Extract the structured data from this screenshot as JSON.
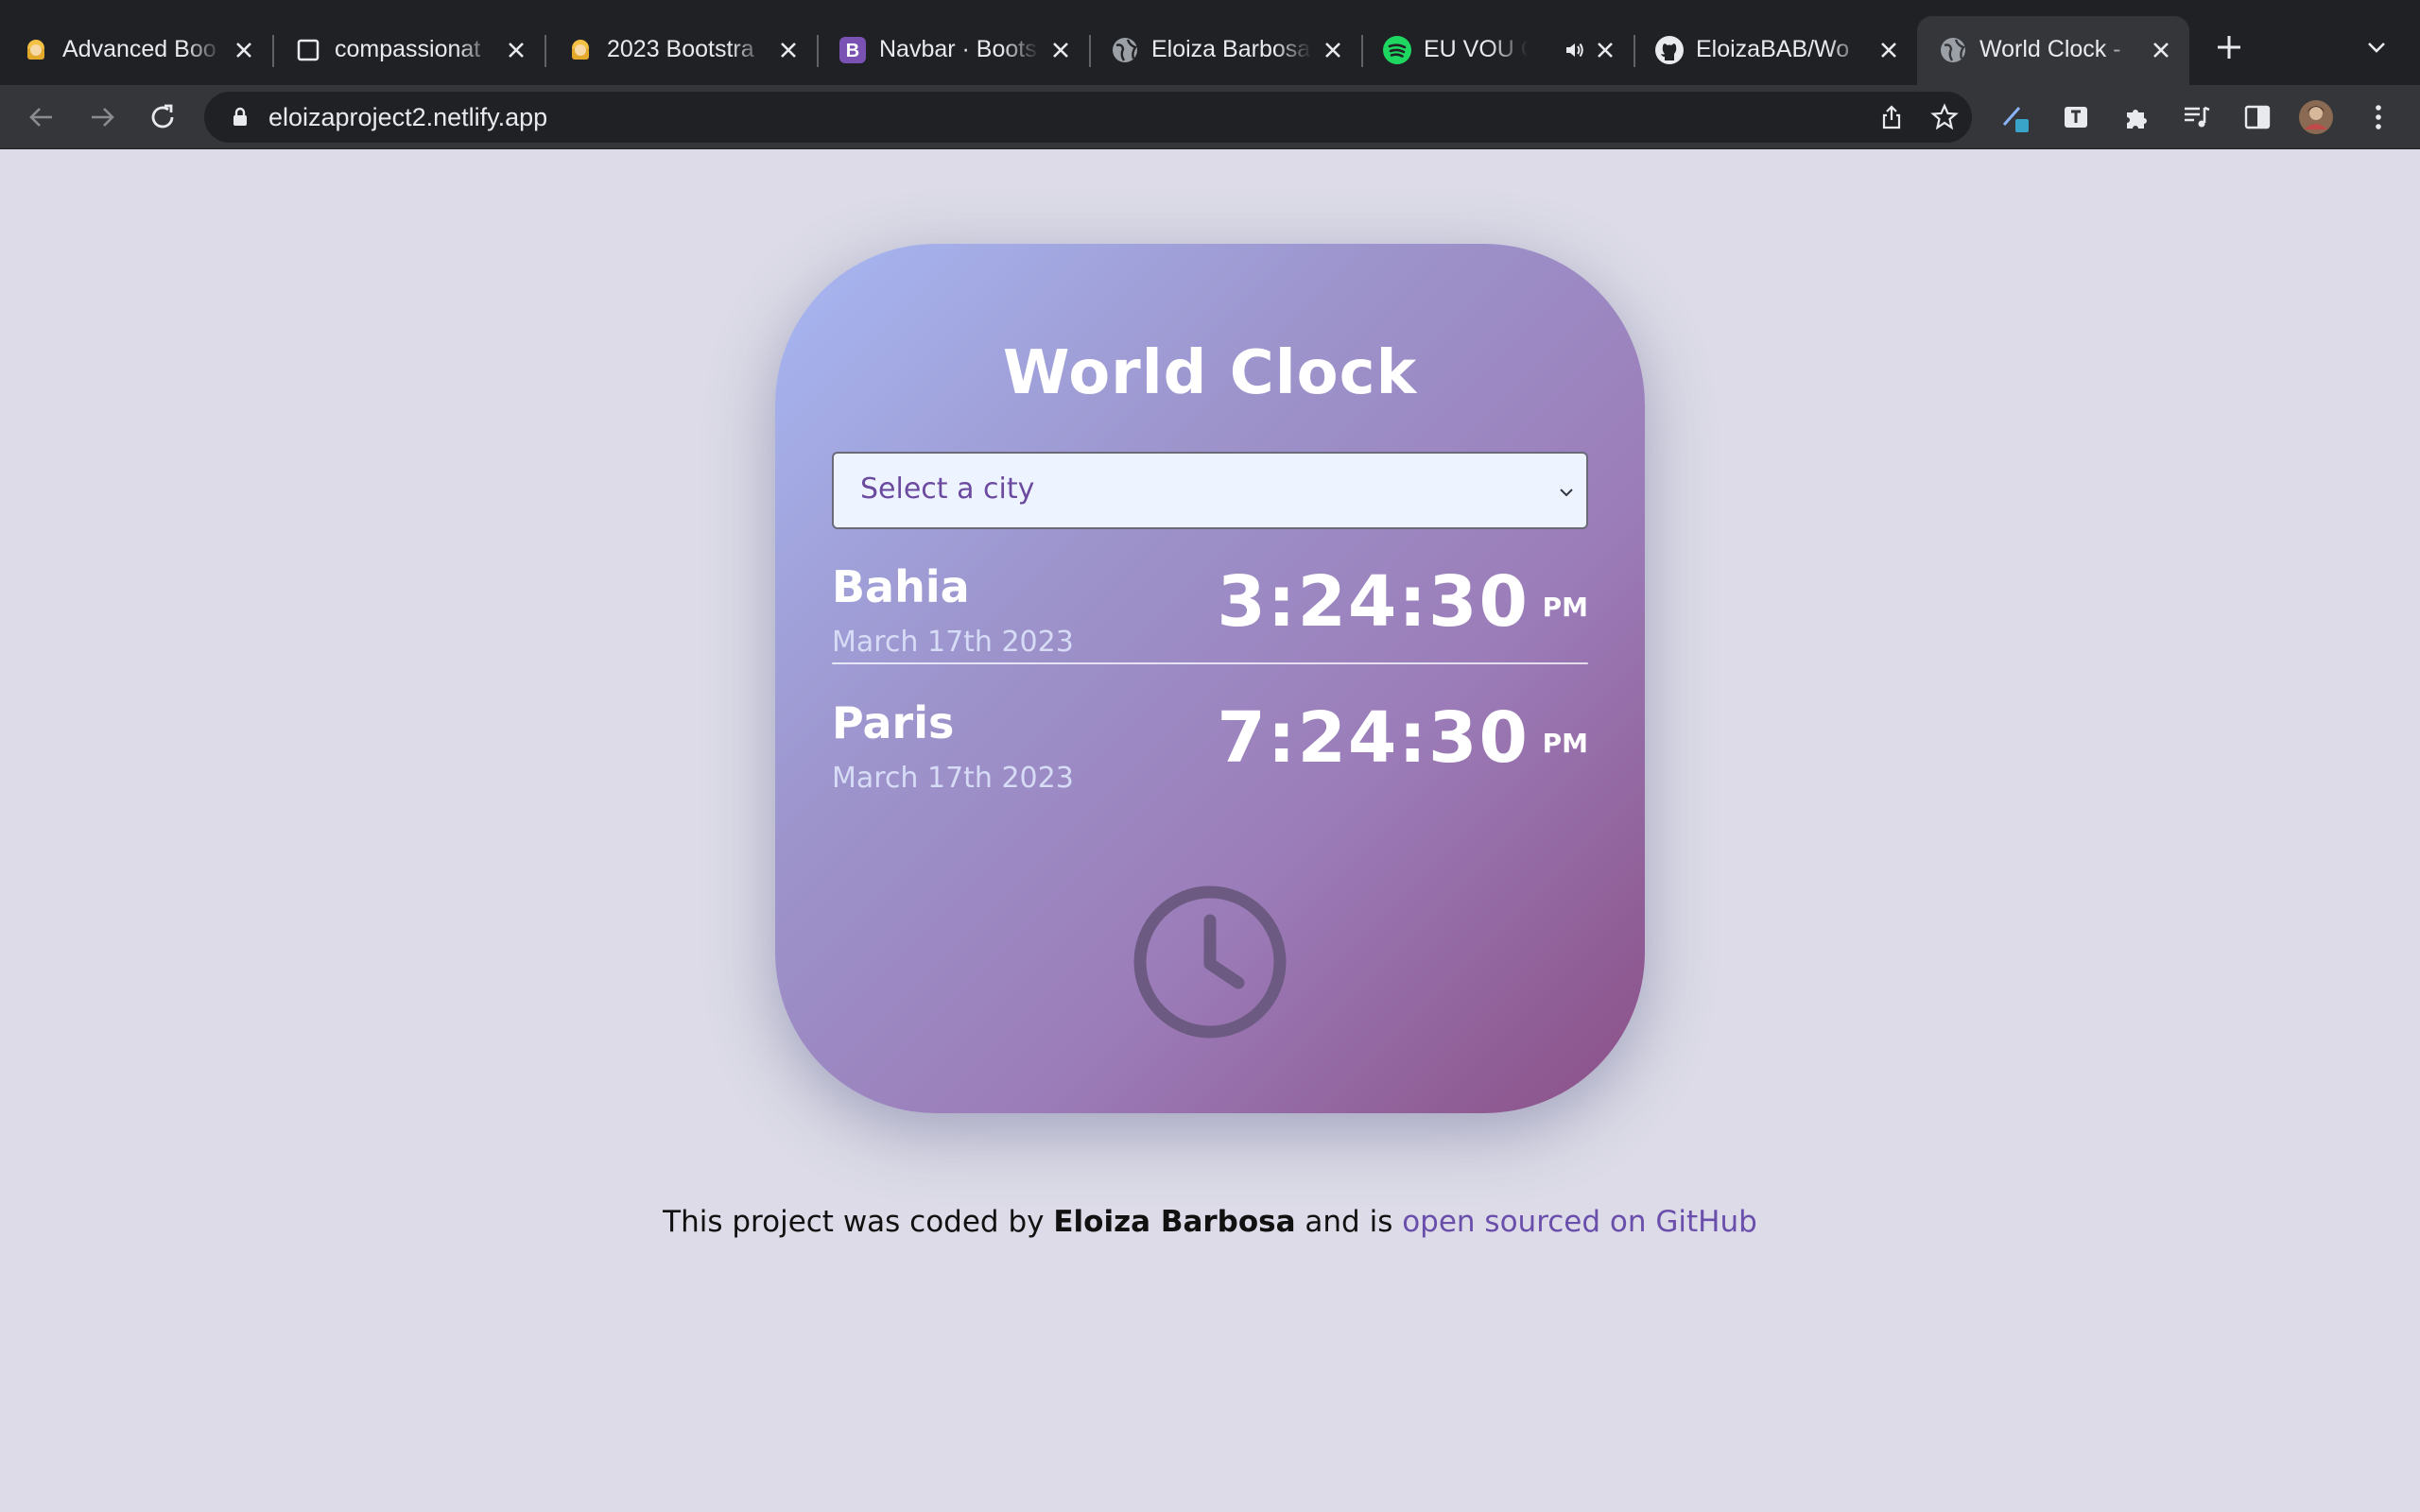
{
  "browser": {
    "tabs": [
      {
        "title": "Advanced Boo",
        "favicon": "emoji-girl-icon"
      },
      {
        "title": "compassionat",
        "favicon": "blank-page-icon"
      },
      {
        "title": "2023 Bootstra",
        "favicon": "emoji-girl-icon"
      },
      {
        "title": "Navbar · Boots",
        "favicon": "bootstrap-icon"
      },
      {
        "title": "Eloiza Barbosa",
        "favicon": "globe-icon"
      },
      {
        "title": "EU VOU C",
        "favicon": "spotify-icon",
        "audio": true
      },
      {
        "title": "EloizaBAB/Wo",
        "favicon": "github-icon"
      },
      {
        "title": "World Clock -",
        "favicon": "globe-icon",
        "active": true
      }
    ],
    "address": "eloizaproject2.netlify.app",
    "colors": {
      "tabbar": "#202124",
      "toolbar": "#35363a",
      "spotify": "#1ed760",
      "bootstrap": "#7952b3"
    }
  },
  "app": {
    "title": "World Clock",
    "select": {
      "placeholder": "Select a city"
    },
    "cities": [
      {
        "name": "Bahia",
        "date": "March 17th 2023",
        "time": "3:24:30",
        "ampm": "PM"
      },
      {
        "name": "Paris",
        "date": "March 17th 2023",
        "time": "7:24:30",
        "ampm": "PM"
      }
    ],
    "icon": "clock-icon"
  },
  "footer": {
    "prefix": "This project was coded by",
    "author": "Eloiza Barbosa",
    "middle": "and is",
    "link": "open sourced on GitHub"
  },
  "colors": {
    "background": "#dcdbe7",
    "card_gradient_start": "#a7b8f3",
    "card_gradient_end": "#8b4f86",
    "link": "#6a4eab",
    "select_text": "#6b4a9f"
  }
}
